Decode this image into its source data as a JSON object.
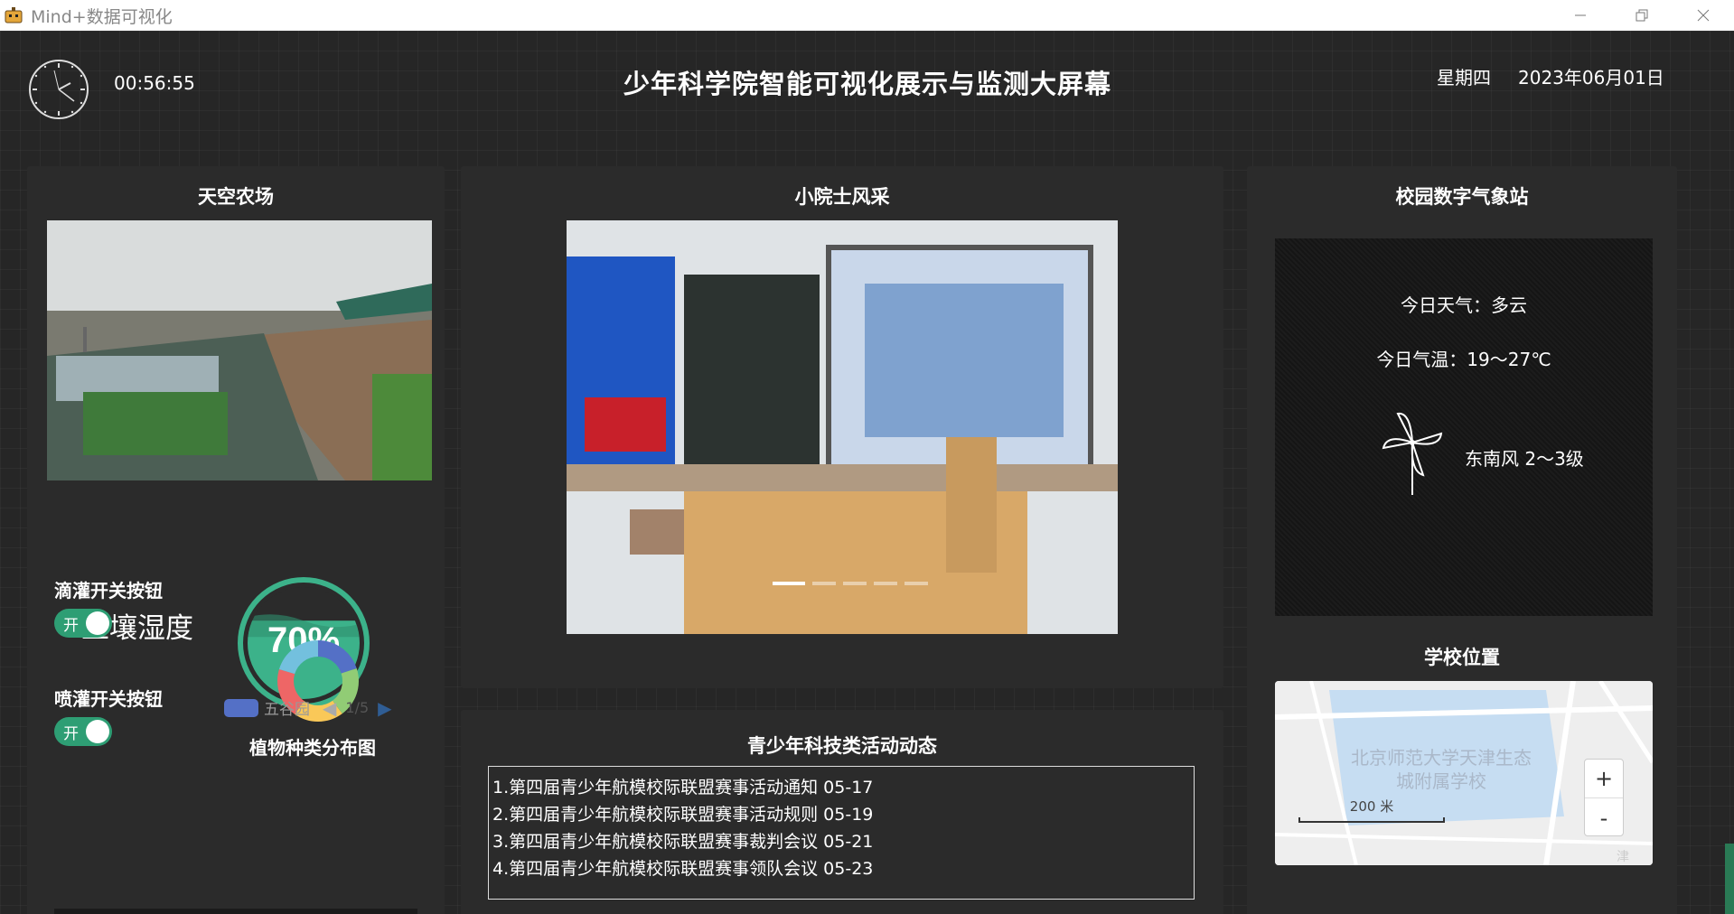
{
  "window": {
    "title": "Mind+数据可视化"
  },
  "header": {
    "time": "00:56:55",
    "title": "少年科学院智能可视化展示与监测大屏幕",
    "weekday": "星期四",
    "date": "2023年06月01日"
  },
  "farm": {
    "title": "天空农场",
    "soil_label": "土壤湿度",
    "soil_moisture_text": "70%",
    "soil_moisture_level": 0.7,
    "drip_label": "滴灌开关按钮",
    "drip_toggle": "开",
    "spray_label": "喷灌开关按钮",
    "spray_toggle": "开",
    "species_title": "植物种类分布图",
    "legend_item": "五谷园",
    "legend_page": "1/5"
  },
  "showcase": {
    "title": "小院士风采",
    "carousel_count": 5,
    "carousel_active": 1
  },
  "news": {
    "title": "青少年科技类活动动态",
    "items": [
      "1.第四届青少年航模校际联盟赛事活动通知 05-17",
      "2.第四届青少年航模校际联盟赛事活动规则 05-19",
      "3.第四届青少年航模校际联盟赛事裁判会议 05-21",
      "4.第四届青少年航模校际联盟赛事领队会议 05-23"
    ]
  },
  "weather": {
    "title": "校园数字气象站",
    "condition": "今日天气：多云",
    "temperature": "今日气温：19～27℃",
    "wind": "东南风 2～3级"
  },
  "location": {
    "title": "学校位置",
    "map_label": "北京师范大学天津生态城附属学校",
    "scale_text": "200 米",
    "zoom_in": "+",
    "zoom_out": "-",
    "corner_text": "津"
  },
  "colors": {
    "toggle_on": "#2e9e74",
    "gauge": "#3cb28a",
    "legend": "#5470c6"
  }
}
